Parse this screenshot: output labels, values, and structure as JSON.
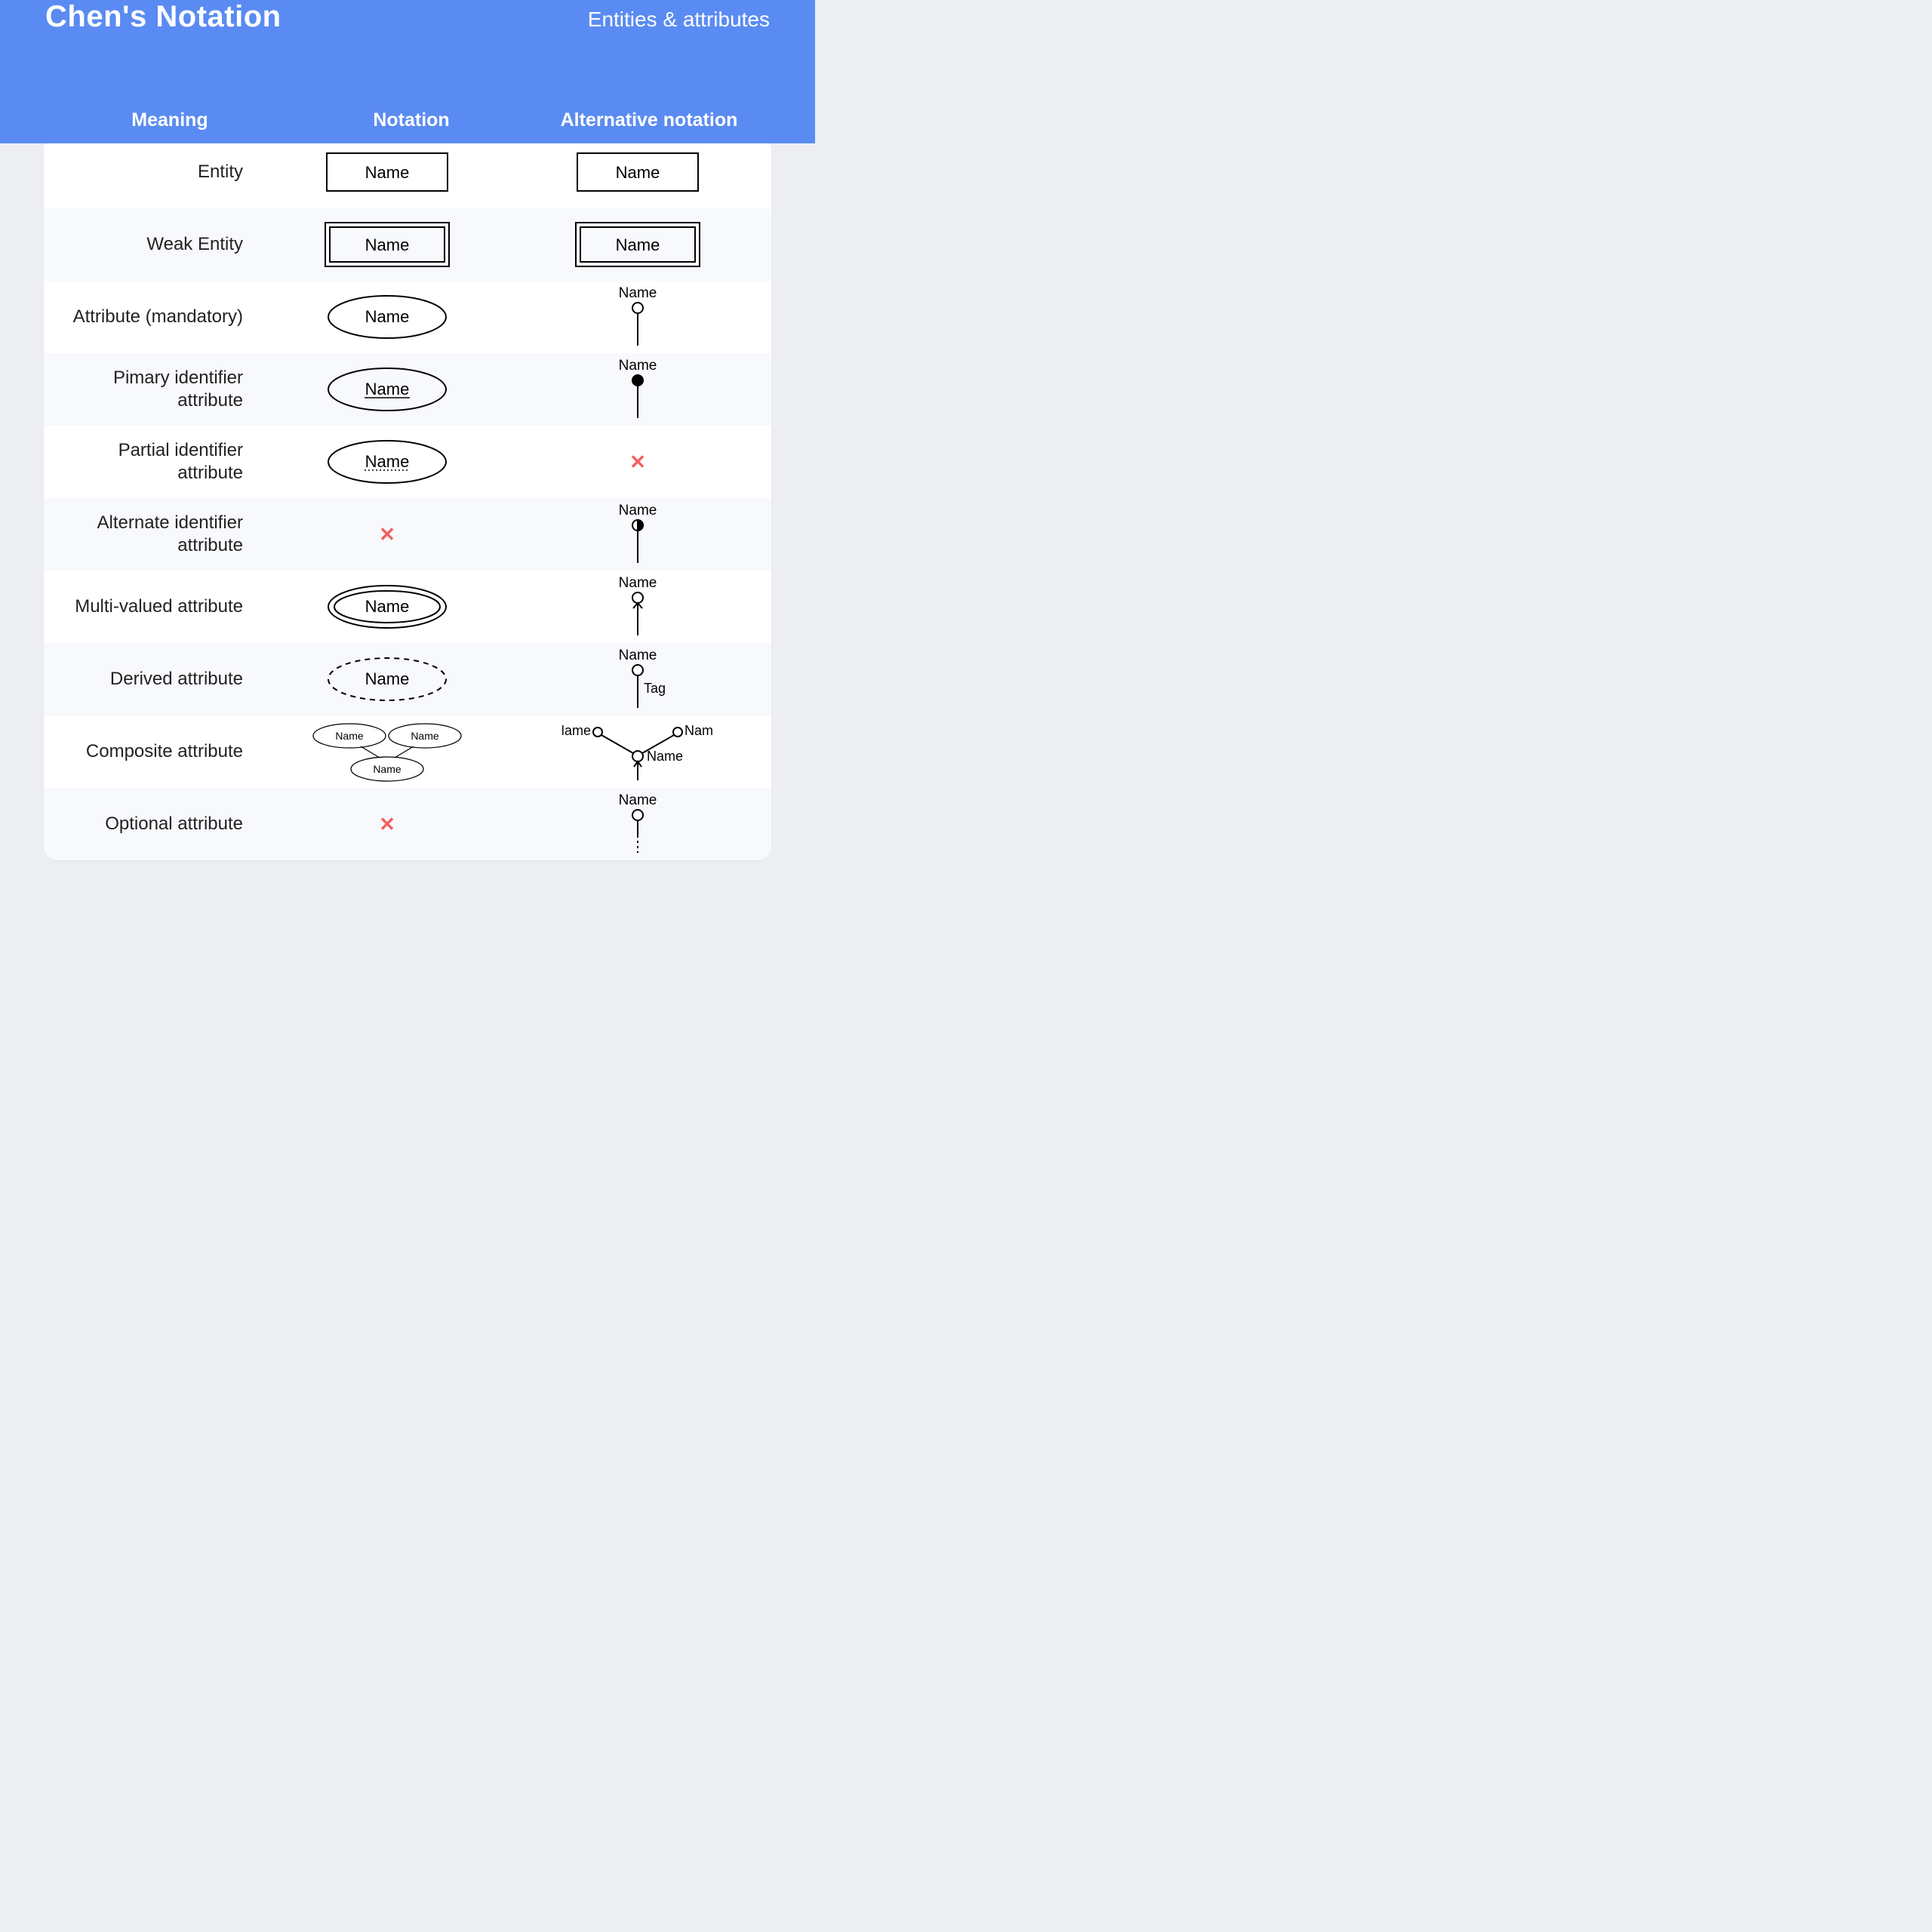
{
  "header": {
    "title": "Chen's Notation",
    "subtitle": "Entities & attributes",
    "col1": "Meaning",
    "col2": "Notation",
    "col3": "Alternative notation"
  },
  "common": {
    "label": "Name",
    "tag": "Tag"
  },
  "rows": [
    {
      "meaning": "Entity",
      "notation": "rect",
      "alt": "rect"
    },
    {
      "meaning": "Weak Entity",
      "notation": "rect-double",
      "alt": "rect-double"
    },
    {
      "meaning": "Attribute (mandatory)",
      "notation": "ellipse",
      "alt": "lolli-open"
    },
    {
      "meaning": "Pimary identifier attribute",
      "notation": "ellipse-underline",
      "alt": "lolli-filled"
    },
    {
      "meaning": "Partial identifier attribute",
      "notation": "ellipse-dotted-underline",
      "alt": "x"
    },
    {
      "meaning": "Alternate identifier attribute",
      "notation": "x",
      "alt": "lolli-half"
    },
    {
      "meaning": "Multi-valued attribute",
      "notation": "ellipse-double",
      "alt": "lolli-arrow"
    },
    {
      "meaning": "Derived attribute",
      "notation": "ellipse-dashed",
      "alt": "lolli-tag"
    },
    {
      "meaning": "Composite attribute",
      "notation": "tree-ellipse",
      "alt": "tree-lolli"
    },
    {
      "meaning": "Optional attribute",
      "notation": "x",
      "alt": "lolli-dashed"
    }
  ]
}
